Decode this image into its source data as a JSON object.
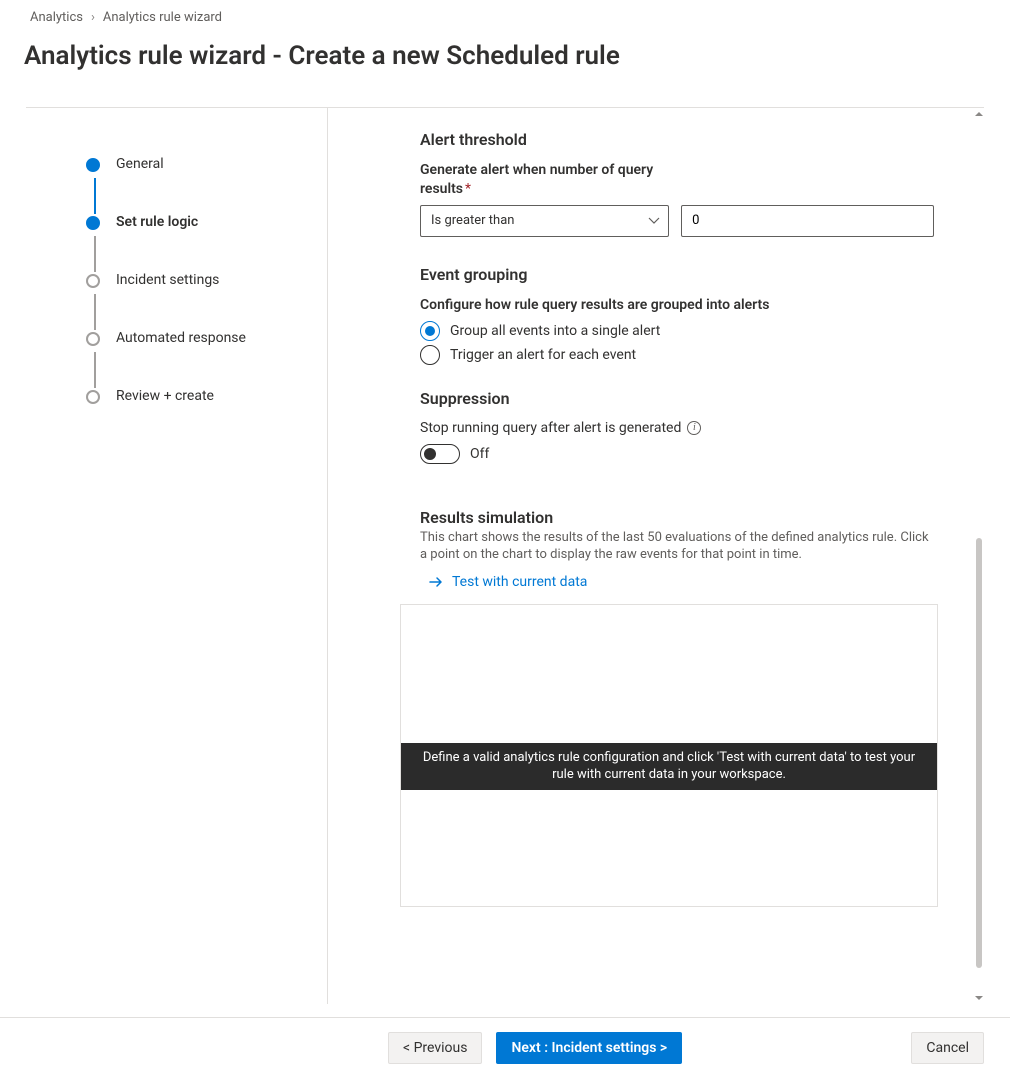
{
  "breadcrumb": {
    "parent": "Analytics",
    "current": "Analytics rule wizard"
  },
  "page_title": "Analytics rule wizard - Create a new Scheduled rule",
  "steps": [
    {
      "label": "General",
      "state": "done"
    },
    {
      "label": "Set rule logic",
      "state": "active"
    },
    {
      "label": "Incident settings",
      "state": "pending"
    },
    {
      "label": "Automated response",
      "state": "pending"
    },
    {
      "label": "Review + create",
      "state": "pending"
    }
  ],
  "sections": {
    "threshold": {
      "title": "Alert threshold",
      "label": "Generate alert when number of query results",
      "operator_selected": "Is greater than",
      "value": "0"
    },
    "grouping": {
      "title": "Event grouping",
      "label": "Configure how rule query results are grouped into alerts",
      "options": [
        "Group all events into a single alert",
        "Trigger an alert for each event"
      ],
      "selected_index": 0
    },
    "suppression": {
      "title": "Suppression",
      "label": "Stop running query after alert is generated",
      "toggle_state": "Off"
    },
    "simulation": {
      "title": "Results simulation",
      "desc": "This chart shows the results of the last 50 evaluations of the defined analytics rule. Click a point on the chart to display the raw events for that point in time.",
      "test_link": "Test with current data",
      "banner": "Define a valid analytics rule configuration and click 'Test with current data' to test your rule with current data in your workspace."
    }
  },
  "footer": {
    "prev": "< Previous",
    "next": "Next : Incident settings >",
    "cancel": "Cancel"
  }
}
